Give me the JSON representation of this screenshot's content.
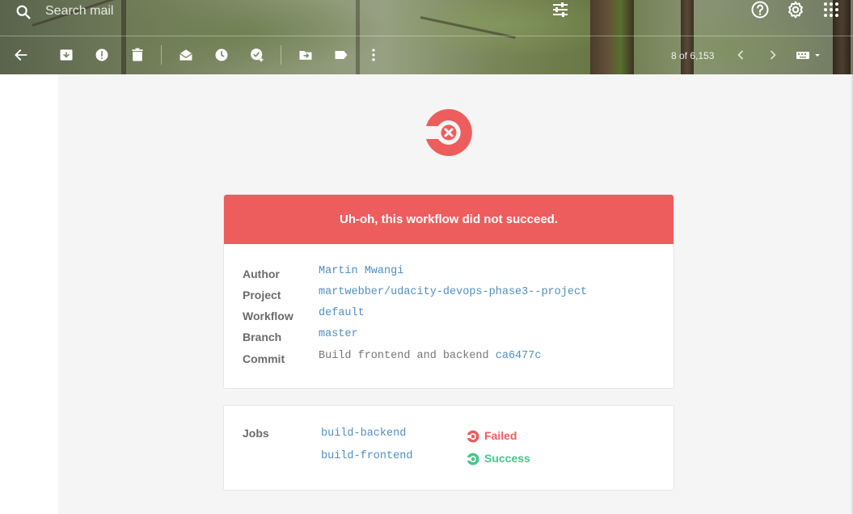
{
  "search": {
    "placeholder": "Search mail"
  },
  "toolbar": {
    "pagination": "8 of 6,153"
  },
  "email": {
    "banner_title": "Uh-oh, this workflow did not succeed.",
    "details": {
      "author_label": "Author",
      "author_value": "Martin Mwangi",
      "project_label": "Project",
      "project_value": "martwebber/udacity-devops-phase3--project",
      "workflow_label": "Workflow",
      "workflow_value": "default",
      "branch_label": "Branch",
      "branch_value": "master",
      "commit_label": "Commit",
      "commit_message": "Build frontend and backend",
      "commit_hash": "ca6477c"
    },
    "jobs": {
      "label": "Jobs",
      "items": [
        {
          "name": "build-backend",
          "status": "Failed",
          "status_color": "#ee5d5d"
        },
        {
          "name": "build-frontend",
          "status": "Success",
          "status_color": "#42c88a"
        }
      ]
    }
  },
  "colors": {
    "failure": "#ee5d5d",
    "success": "#42c88a",
    "link": "#4f8fc5"
  }
}
